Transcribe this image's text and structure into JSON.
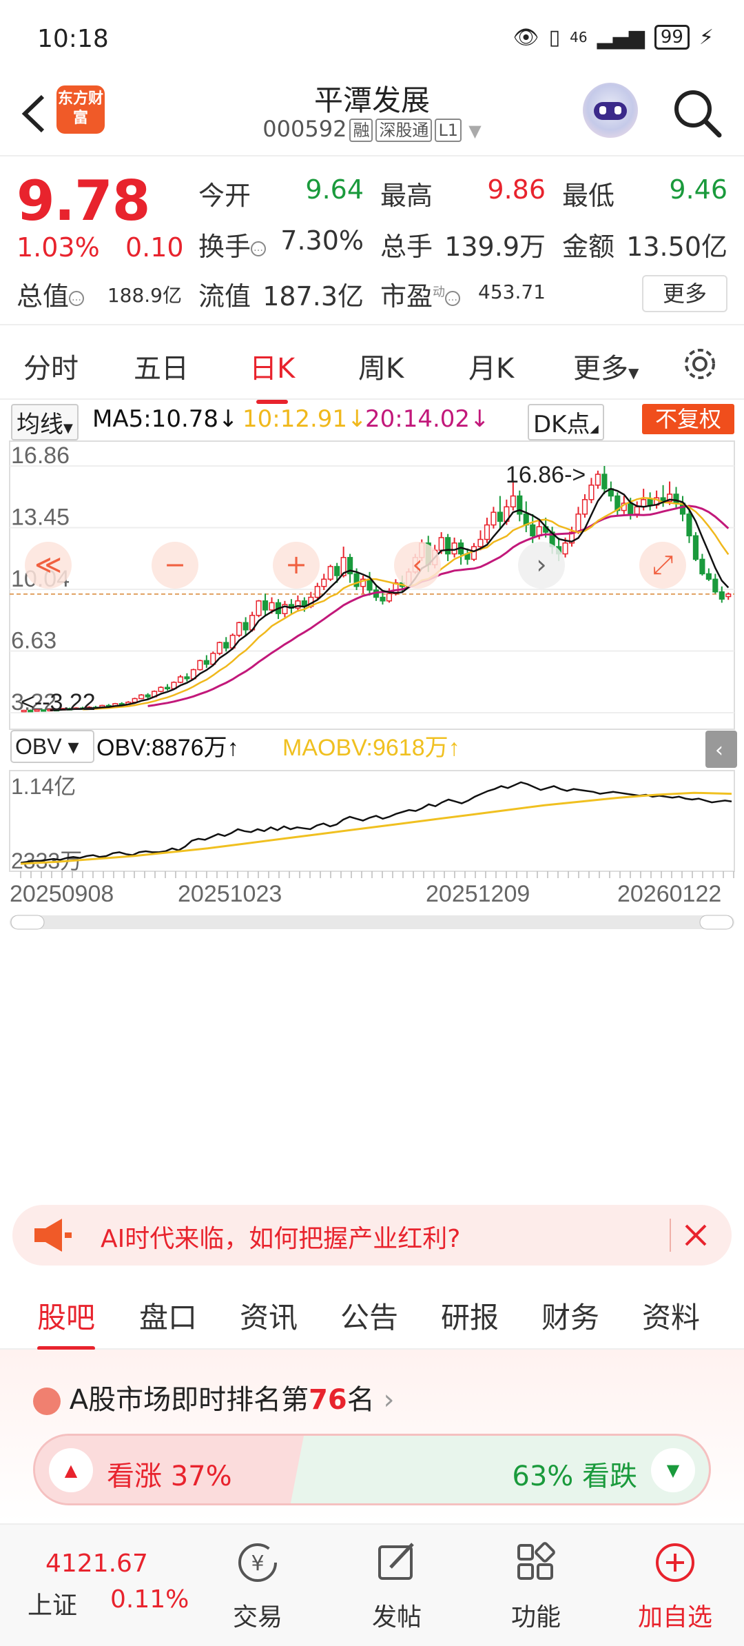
{
  "status_bar": {
    "time": "10:18",
    "signal": "46",
    "battery": "99"
  },
  "header": {
    "title": "平潭发展",
    "code": "000592",
    "tag1": "融",
    "tag2": "深股通",
    "tag3": "L1",
    "logo": "东方财富"
  },
  "quote": {
    "price": "9.78",
    "change_pct": "1.03%",
    "change": "0.10",
    "open_label": "今开",
    "open": "9.64",
    "high_label": "最高",
    "high": "9.86",
    "low_label": "最低",
    "low": "9.46",
    "turnover_label": "换手",
    "turnover": "7.30%",
    "volume_label": "总手",
    "volume": "139.9万",
    "amount_label": "金额",
    "amount": "13.50亿",
    "mcap_label": "总值",
    "mcap": "188.9亿",
    "float_label": "流值",
    "float": "187.3亿",
    "pe_label": "市盈",
    "pe_sup": "动",
    "pe": "453.71",
    "more": "更多"
  },
  "tabs": [
    "分时",
    "五日",
    "日K",
    "周K",
    "月K",
    "更多"
  ],
  "ma": {
    "btn": "均线",
    "ma5": "MA5:10.78",
    "ma10": "10:12.91",
    "ma20": "20:14.02",
    "dk": "DK点",
    "fuquan": "不复权"
  },
  "colors": {
    "red": "#e8232d",
    "green": "#1a9a3c",
    "ma5": "#111111",
    "ma10": "#f0b81c",
    "ma20": "#c2187a",
    "obv": "#111111",
    "maobv": "#f0c020"
  },
  "chart_data": {
    "type": "candlestick",
    "y_ticks": [
      "16.86",
      "13.45",
      "10.04",
      "6.63",
      "3.22"
    ],
    "high_label": "16.86->",
    "low_label": "<--3.22",
    "obv": {
      "btn": "OBV",
      "obv": "OBV:8876万",
      "maobv": "MAOBV:9618万",
      "ymax": "1.14亿",
      "ymin": "2333万"
    },
    "x_ticks": [
      "20250908",
      "20251023",
      "20251209",
      "20260122"
    ],
    "candles": [
      [
        3.3,
        3.35,
        3.25,
        3.38
      ],
      [
        3.35,
        3.32,
        3.28,
        3.4
      ],
      [
        3.32,
        3.38,
        3.3,
        3.42
      ],
      [
        3.38,
        3.34,
        3.3,
        3.4
      ],
      [
        3.34,
        3.4,
        3.32,
        3.44
      ],
      [
        3.4,
        3.38,
        3.33,
        3.45
      ],
      [
        3.38,
        3.45,
        3.36,
        3.48
      ],
      [
        3.45,
        3.42,
        3.38,
        3.5
      ],
      [
        3.42,
        3.48,
        3.4,
        3.52
      ],
      [
        3.48,
        3.46,
        3.42,
        3.55
      ],
      [
        3.46,
        3.52,
        3.44,
        3.58
      ],
      [
        3.52,
        3.5,
        3.46,
        3.6
      ],
      [
        3.5,
        3.62,
        3.48,
        3.66
      ],
      [
        3.62,
        3.58,
        3.52,
        3.7
      ],
      [
        3.58,
        3.72,
        3.55,
        3.76
      ],
      [
        3.72,
        3.68,
        3.62,
        3.8
      ],
      [
        3.68,
        3.8,
        3.66,
        3.86
      ],
      [
        3.8,
        4.0,
        3.78,
        4.05
      ],
      [
        4.0,
        4.2,
        3.98,
        4.25
      ],
      [
        4.2,
        4.1,
        4.0,
        4.3
      ],
      [
        4.1,
        4.4,
        4.05,
        4.45
      ],
      [
        4.4,
        4.62,
        4.35,
        4.68
      ],
      [
        4.62,
        4.55,
        4.45,
        4.8
      ],
      [
        4.55,
        4.9,
        4.5,
        4.95
      ],
      [
        4.9,
        5.2,
        4.85,
        5.3
      ],
      [
        5.2,
        5.1,
        4.95,
        5.4
      ],
      [
        5.1,
        5.6,
        5.05,
        5.65
      ],
      [
        5.6,
        6.1,
        5.55,
        6.15
      ],
      [
        6.1,
        5.9,
        5.7,
        6.4
      ],
      [
        5.9,
        6.5,
        5.8,
        6.6
      ],
      [
        6.5,
        7.1,
        6.4,
        7.15
      ],
      [
        7.1,
        6.8,
        6.6,
        7.4
      ],
      [
        6.8,
        7.5,
        6.7,
        7.6
      ],
      [
        7.5,
        8.2,
        7.4,
        8.25
      ],
      [
        8.2,
        7.8,
        7.5,
        8.5
      ],
      [
        7.8,
        8.6,
        7.7,
        8.8
      ],
      [
        8.6,
        9.4,
        8.5,
        9.45
      ],
      [
        9.4,
        8.9,
        8.6,
        9.8
      ],
      [
        8.9,
        9.3,
        8.7,
        9.6
      ],
      [
        9.3,
        8.7,
        8.4,
        9.5
      ],
      [
        8.7,
        9.2,
        8.5,
        9.4
      ],
      [
        9.2,
        9.0,
        8.7,
        9.5
      ],
      [
        9.0,
        9.4,
        8.8,
        9.7
      ],
      [
        9.4,
        9.1,
        8.8,
        9.6
      ],
      [
        9.1,
        9.6,
        9.0,
        9.9
      ],
      [
        9.6,
        10.2,
        9.5,
        10.4
      ],
      [
        10.2,
        10.6,
        10.0,
        10.9
      ],
      [
        10.6,
        11.3,
        10.5,
        11.4
      ],
      [
        11.3,
        10.8,
        10.4,
        11.5
      ],
      [
        10.8,
        11.8,
        10.7,
        12.4
      ],
      [
        11.8,
        10.9,
        10.4,
        12.0
      ],
      [
        10.9,
        10.2,
        10.0,
        11.2
      ],
      [
        10.2,
        10.6,
        9.8,
        10.8
      ],
      [
        10.6,
        10.0,
        9.7,
        11.0
      ],
      [
        10.0,
        9.6,
        9.4,
        10.3
      ],
      [
        9.6,
        9.4,
        9.2,
        9.9
      ],
      [
        9.4,
        9.8,
        9.3,
        10.1
      ],
      [
        9.8,
        10.4,
        9.7,
        10.6
      ],
      [
        10.4,
        10.2,
        9.9,
        10.8
      ],
      [
        10.2,
        11.0,
        10.1,
        11.2
      ],
      [
        11.0,
        11.8,
        10.9,
        12.0
      ],
      [
        11.8,
        12.6,
        11.6,
        12.8
      ],
      [
        12.6,
        11.4,
        11.0,
        13.0
      ],
      [
        11.4,
        12.2,
        11.2,
        12.5
      ],
      [
        12.2,
        12.9,
        12.0,
        13.2
      ],
      [
        12.9,
        12.0,
        11.6,
        13.1
      ],
      [
        12.0,
        12.6,
        11.8,
        12.9
      ],
      [
        12.6,
        12.0,
        11.4,
        12.8
      ],
      [
        12.0,
        11.7,
        11.4,
        12.3
      ],
      [
        11.7,
        12.4,
        11.6,
        12.6
      ],
      [
        12.4,
        12.8,
        12.2,
        13.3
      ],
      [
        12.8,
        13.6,
        12.6,
        14.0
      ],
      [
        13.6,
        14.3,
        13.4,
        14.6
      ],
      [
        14.3,
        13.8,
        13.4,
        15.2
      ],
      [
        13.8,
        14.6,
        13.6,
        15.0
      ],
      [
        14.6,
        15.2,
        14.4,
        16.0
      ],
      [
        15.2,
        14.2,
        13.8,
        15.5
      ],
      [
        14.2,
        13.6,
        13.2,
        14.9
      ],
      [
        13.6,
        13.0,
        12.6,
        14.2
      ],
      [
        13.0,
        13.5,
        12.8,
        13.9
      ],
      [
        13.5,
        13.2,
        12.9,
        14.0
      ],
      [
        13.2,
        12.4,
        12.0,
        13.5
      ],
      [
        12.4,
        12.0,
        11.6,
        12.9
      ],
      [
        12.0,
        12.6,
        11.8,
        12.9
      ],
      [
        12.6,
        13.2,
        12.4,
        13.5
      ],
      [
        13.2,
        14.2,
        13.1,
        14.6
      ],
      [
        14.2,
        15.0,
        14.0,
        15.3
      ],
      [
        15.0,
        15.8,
        14.8,
        16.2
      ],
      [
        15.8,
        16.4,
        15.6,
        16.6
      ],
      [
        16.4,
        15.6,
        15.3,
        16.86
      ],
      [
        15.6,
        15.2,
        14.9,
        16.0
      ],
      [
        15.2,
        14.4,
        14.1,
        15.4
      ],
      [
        14.4,
        14.8,
        14.2,
        15.2
      ],
      [
        14.8,
        14.2,
        13.9,
        15.1
      ],
      [
        14.2,
        14.6,
        14.0,
        14.9
      ],
      [
        14.6,
        15.0,
        14.4,
        15.6
      ],
      [
        15.0,
        14.7,
        14.4,
        15.4
      ],
      [
        14.7,
        15.1,
        14.5,
        15.5
      ],
      [
        15.1,
        14.9,
        14.6,
        15.8
      ],
      [
        14.9,
        15.3,
        14.7,
        16.0
      ],
      [
        15.3,
        14.8,
        14.5,
        15.7
      ],
      [
        14.8,
        14.2,
        13.8,
        15.2
      ],
      [
        14.2,
        13.0,
        12.6,
        14.5
      ],
      [
        13.0,
        11.7,
        11.6,
        13.2
      ],
      [
        11.7,
        10.9,
        10.8,
        12.0
      ],
      [
        10.9,
        10.6,
        10.5,
        11.2
      ],
      [
        10.6,
        9.9,
        9.8,
        10.9
      ],
      [
        9.9,
        9.5,
        9.3,
        10.2
      ],
      [
        9.64,
        9.78,
        9.46,
        9.86
      ]
    ],
    "obv_values": [
      0.25,
      0.26,
      0.27,
      0.27,
      0.28,
      0.29,
      0.28,
      0.3,
      0.31,
      0.3,
      0.32,
      0.33,
      0.31,
      0.32,
      0.35,
      0.36,
      0.34,
      0.33,
      0.36,
      0.37,
      0.36,
      0.36,
      0.37,
      0.4,
      0.38,
      0.42,
      0.48,
      0.5,
      0.49,
      0.52,
      0.55,
      0.53,
      0.56,
      0.6,
      0.58,
      0.57,
      0.6,
      0.58,
      0.62,
      0.59,
      0.63,
      0.6,
      0.62,
      0.61,
      0.6,
      0.64,
      0.66,
      0.63,
      0.65,
      0.7,
      0.73,
      0.71,
      0.69,
      0.72,
      0.74,
      0.71,
      0.73,
      0.76,
      0.78,
      0.8,
      0.79,
      0.82,
      0.86,
      0.84,
      0.88,
      0.91,
      0.89,
      0.87,
      0.9,
      0.94,
      0.97,
      1.0,
      1.02,
      1.05,
      1.03,
      1.06,
      1.09,
      1.07,
      1.04,
      1.01,
      1.03,
      1.05,
      1.02,
      1.0,
      1.02,
      1.01,
      1.0,
      0.99,
      0.97,
      0.98,
      0.99,
      0.98,
      0.97,
      0.96,
      0.95,
      0.96,
      0.94,
      0.95,
      0.94,
      0.93,
      0.94,
      0.92,
      0.91,
      0.92,
      0.9,
      0.88,
      0.89,
      0.9,
      0.89
    ],
    "maobv_values": [
      0.24,
      0.26,
      0.29,
      0.32,
      0.36,
      0.4,
      0.45,
      0.5,
      0.55,
      0.6,
      0.65,
      0.7,
      0.75,
      0.8,
      0.85,
      0.89,
      0.93,
      0.96,
      0.98,
      0.97
    ]
  },
  "banner": {
    "text": "AI时代来临，如何把握产业红利?"
  },
  "bottom_tabs": [
    "股吧",
    "盘口",
    "资讯",
    "公告",
    "研报",
    "财务",
    "资料"
  ],
  "rank": {
    "prefix": "A股市场即时排名第",
    "num": "76",
    "suffix": "名"
  },
  "vote": {
    "up": "看涨 37%",
    "down": "63% 看跌"
  },
  "bottom_nav": {
    "index_value": "4121.67",
    "index_name": "上证",
    "index_change": "0.11%",
    "trade": "交易",
    "post": "发帖",
    "func": "功能",
    "add": "加自选"
  }
}
